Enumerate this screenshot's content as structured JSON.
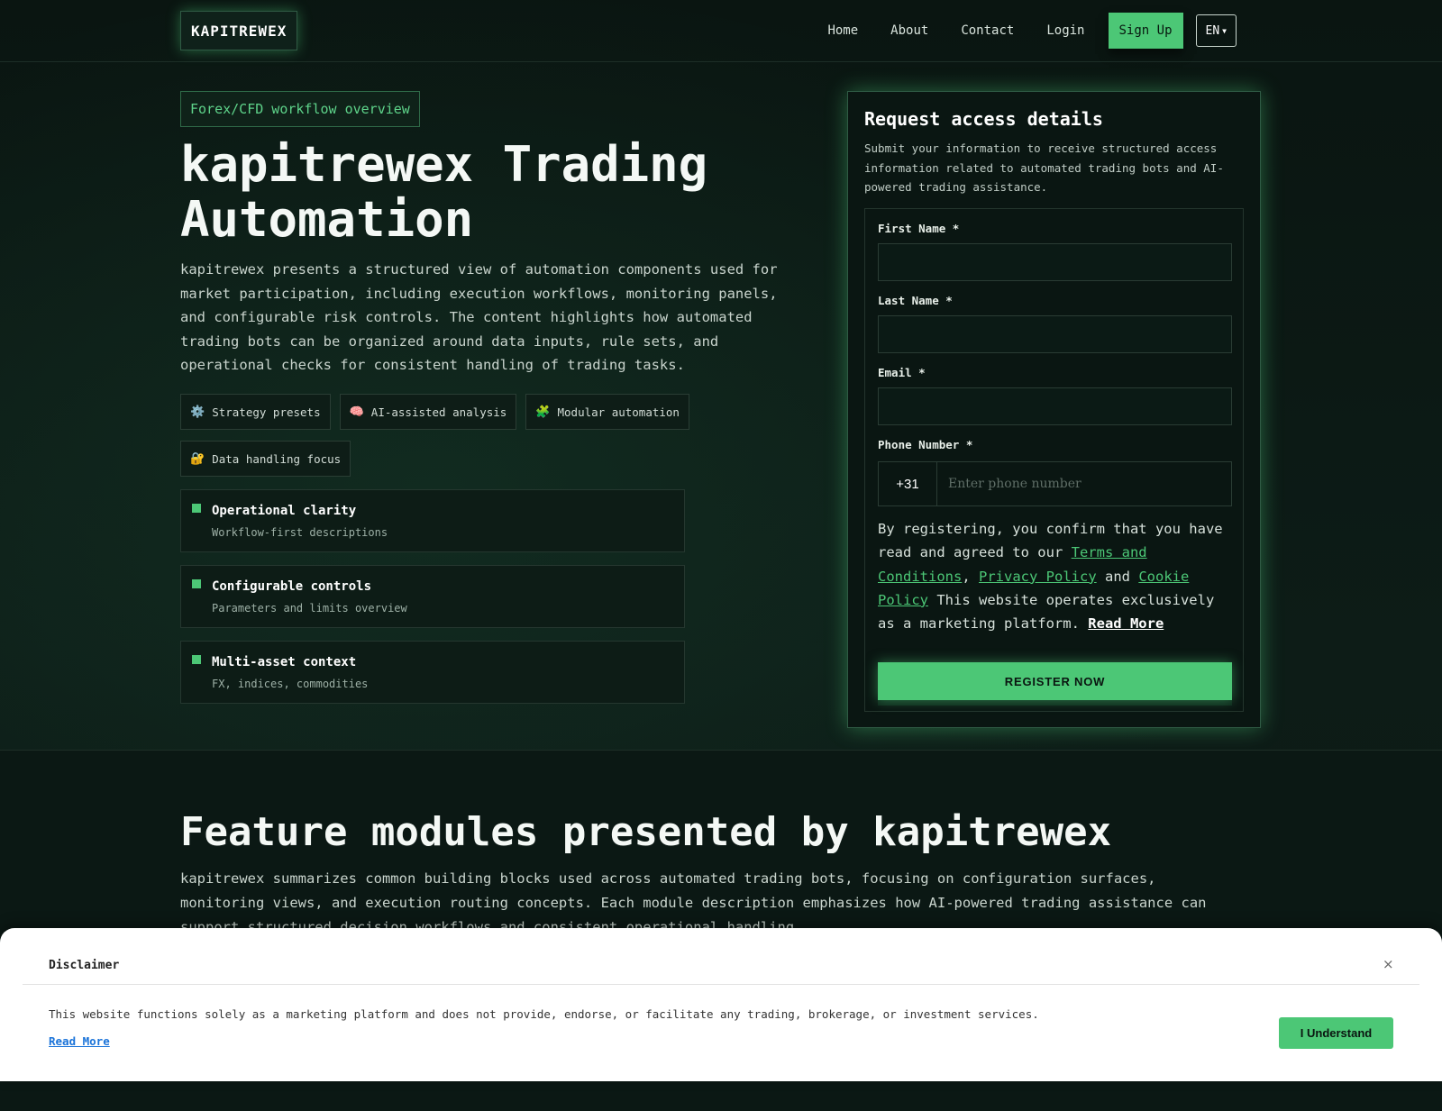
{
  "brand": {
    "logo_text": "KAPITREWEX",
    "accent_color": "#4cc776"
  },
  "nav": {
    "links": [
      "Home",
      "About",
      "Contact",
      "Login"
    ],
    "signup_label": "Sign Up",
    "language": "EN"
  },
  "hero": {
    "tag": "Forex/CFD workflow overview",
    "title": "kapitrewex Trading Automation",
    "description": "kapitrewex presents a structured view of automation components used for market participation, including execution workflows, monitoring panels, and configurable risk controls. The content highlights how automated trading bots can be organized around data inputs, rule sets, and operational checks for consistent handling of trading tasks.",
    "chips": [
      {
        "icon": "gear-icon",
        "glyph": "⚙️",
        "label": "Strategy presets"
      },
      {
        "icon": "brain-icon",
        "glyph": "🧠",
        "label": "AI-assisted analysis"
      },
      {
        "icon": "puzzle-icon",
        "glyph": "🧩",
        "label": "Modular automation"
      },
      {
        "icon": "lock-icon",
        "glyph": "🔐",
        "label": "Data handling focus"
      }
    ],
    "features": [
      {
        "title": "Operational clarity",
        "subtitle": "Workflow-first descriptions"
      },
      {
        "title": "Configurable controls",
        "subtitle": "Parameters and limits overview"
      },
      {
        "title": "Multi-asset context",
        "subtitle": "FX, indices, commodities"
      }
    ]
  },
  "form": {
    "title": "Request access details",
    "subtitle": "Submit your information to receive structured access information related to automated trading bots and AI-powered trading assistance.",
    "first_name_label": "First Name *",
    "last_name_label": "Last Name *",
    "email_label": "Email *",
    "phone_label": "Phone Number *",
    "phone_code": "+31",
    "phone_placeholder": "Enter phone number",
    "consent_prefix": "By registering, you confirm that you have read and agreed to our ",
    "terms_label": "Terms and Conditions",
    "comma": ", ",
    "privacy_label": "Privacy Policy",
    "and_word": " and ",
    "cookie_label": "Cookie Policy",
    "consent_suffix": " This website operates exclusively as a marketing platform. ",
    "read_more_label": "Read More",
    "submit_label": "REGISTER NOW"
  },
  "modules": {
    "title": "Feature modules presented by kapitrewex",
    "description": "kapitrewex summarizes common building blocks used across automated trading bots, focusing on configuration surfaces, monitoring views, and execution routing concepts. Each module description emphasizes how AI-powered trading assistance can support structured decision workflows and consistent operational handling."
  },
  "disclaimer": {
    "title": "Disclaimer",
    "close_glyph": "×",
    "text": "This website functions solely as a marketing platform and does not provide, endorse, or facilitate any trading, brokerage, or investment services.",
    "read_more_label": "Read More",
    "button_label": "I Understand"
  }
}
